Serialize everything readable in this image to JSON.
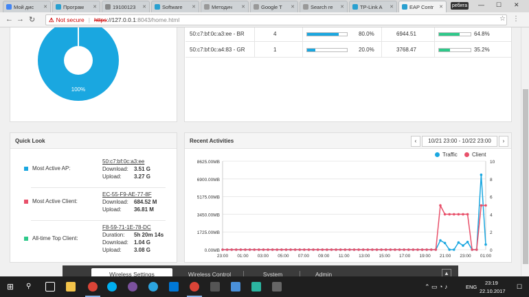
{
  "browser": {
    "tabs": [
      {
        "label": "Мой дис",
        "color": "#4285f4"
      },
      {
        "label": "Програм",
        "color": "#29a0d0"
      },
      {
        "label": "19100123",
        "color": "#888888"
      },
      {
        "label": "Software",
        "color": "#29a0d0"
      },
      {
        "label": "Методич",
        "color": "#999999"
      },
      {
        "label": "Google T",
        "color": "#999999"
      },
      {
        "label": "Search re",
        "color": "#999999"
      },
      {
        "label": "TP-Link A",
        "color": "#29a0d0"
      },
      {
        "label": "EAP Contr",
        "color": "#29a0d0"
      }
    ],
    "profile": "ребята",
    "address": {
      "security": "Not secure",
      "scheme": "https",
      "host": "://127.0.0.1",
      "path": ":8043/home.html"
    }
  },
  "clients_table": {
    "rows": [
      {
        "mac": "50:c7:bf:0c:a3:ee - BR",
        "count": "4",
        "percent1": "80.0%",
        "fill1": 0.8,
        "traffic": "6944.51",
        "percent2": "64.8%",
        "fill2": 0.648
      },
      {
        "mac": "50:c7:bf:0c:a4:83 - GR",
        "count": "1",
        "percent1": "20.0%",
        "fill1": 0.2,
        "traffic": "3768.47",
        "percent2": "35.2%",
        "fill2": 0.352
      }
    ]
  },
  "donut": {
    "label": "100%",
    "color": "#1aa7e0"
  },
  "quick_look": {
    "title": "Quick Look",
    "items": [
      {
        "title": "Most Active AP:",
        "name": "50:c7:bf:0c:a3:ee",
        "color": "#1aa7e0",
        "rows": [
          {
            "k": "Download:",
            "v": "3.51 G"
          },
          {
            "k": "Upload:",
            "v": "3.27 G"
          }
        ]
      },
      {
        "title": "Most Active Client:",
        "name": "EC-55-F9-AE-77-8F",
        "color": "#e8506a",
        "rows": [
          {
            "k": "Download:",
            "v": "684.52 M"
          },
          {
            "k": "Upload:",
            "v": "36.81 M"
          }
        ]
      },
      {
        "title": "All-time Top Client:",
        "name": "F8-59-71-1E-78-DC",
        "color": "#2ec98a",
        "rows": [
          {
            "k": "Duration:",
            "v": "5h 20m 14s"
          },
          {
            "k": "Download:",
            "v": "1.04 G"
          },
          {
            "k": "Upload:",
            "v": "3.08 G"
          }
        ]
      }
    ]
  },
  "recent": {
    "title": "Recent Activities",
    "date_range": "10/21 23:00 - 10/22 23:00",
    "prev": "‹",
    "next": "›"
  },
  "chart_data": {
    "type": "line",
    "title": "",
    "x": [
      "23:00",
      "01:00",
      "03:00",
      "05:00",
      "07:00",
      "09:00",
      "11:00",
      "13:00",
      "15:00",
      "17:00",
      "19:00",
      "21:00",
      "23:00",
      "01:00"
    ],
    "xlabel": "",
    "ylabel": "",
    "yleft_ticks": [
      "0.00MB",
      "1725.00MB",
      "3450.00MB",
      "5175.00MB",
      "6900.00MB",
      "8625.00MB"
    ],
    "yright_ticks": [
      "0",
      "2",
      "4",
      "6",
      "8",
      "10"
    ],
    "ylim_left": [
      0,
      8625
    ],
    "ylim_right": [
      0,
      10
    ],
    "legend_position": "top-right",
    "series": [
      {
        "name": "Traffic",
        "color": "#1aa7e0",
        "axis": "left",
        "values": [
          0,
          0,
          0,
          0,
          0,
          0,
          0,
          0,
          0,
          0,
          0,
          0,
          0,
          0,
          0,
          0,
          0,
          0,
          0,
          0,
          0,
          0,
          0,
          0,
          0,
          0,
          0,
          0,
          0,
          0,
          0,
          0,
          0,
          0,
          0,
          0,
          0,
          0,
          0,
          0,
          0,
          0,
          0,
          0,
          0,
          0,
          0,
          0,
          0,
          0,
          0,
          0,
          0,
          0,
          0,
          0,
          0,
          0,
          0,
          0,
          0,
          0,
          0,
          0,
          0,
          0,
          0,
          0,
          0,
          0,
          0,
          0,
          0,
          0,
          0,
          0,
          0,
          0,
          0,
          0,
          0,
          0,
          0,
          0,
          0,
          0,
          0,
          0,
          0,
          0,
          0,
          0,
          0,
          0,
          0,
          0,
          0,
          0,
          0,
          0,
          0,
          0,
          0,
          0,
          0,
          0,
          0,
          0
        ],
        "points": [
          [
            0,
            0
          ],
          [
            1,
            0
          ],
          [
            2,
            0
          ],
          [
            3,
            0
          ],
          [
            4,
            0
          ],
          [
            5,
            0
          ],
          [
            6,
            0
          ],
          [
            7,
            0
          ],
          [
            8,
            0
          ],
          [
            9,
            0
          ],
          [
            10,
            0
          ],
          [
            11,
            0
          ],
          [
            12,
            0
          ],
          [
            13,
            0
          ],
          [
            14,
            0
          ],
          [
            15,
            0
          ],
          [
            16,
            0
          ],
          [
            17,
            0
          ],
          [
            18,
            0
          ],
          [
            19,
            0
          ],
          [
            20,
            0
          ],
          [
            21,
            0
          ],
          [
            22,
            0
          ],
          [
            23,
            0
          ],
          [
            24,
            0
          ],
          [
            25,
            0
          ],
          [
            26,
            0
          ],
          [
            27,
            0
          ],
          [
            28,
            0
          ],
          [
            29,
            0
          ],
          [
            30,
            0
          ],
          [
            31,
            0
          ],
          [
            32,
            0
          ],
          [
            33,
            0
          ],
          [
            34,
            0
          ],
          [
            35,
            0
          ],
          [
            36,
            0
          ],
          [
            37,
            0
          ],
          [
            38,
            0
          ],
          [
            39,
            0
          ],
          [
            40,
            0
          ],
          [
            41,
            0
          ],
          [
            42,
            0
          ],
          [
            43,
            0
          ],
          [
            44,
            0
          ],
          [
            45,
            0
          ],
          [
            46,
            0
          ],
          [
            47,
            0
          ],
          [
            48,
            900
          ],
          [
            49,
            650
          ],
          [
            50,
            0
          ],
          [
            51,
            0
          ],
          [
            52,
            700
          ],
          [
            53,
            400
          ],
          [
            54,
            750
          ],
          [
            55,
            0
          ],
          [
            56,
            0
          ],
          [
            57,
            7300
          ],
          [
            58,
            500
          ]
        ]
      },
      {
        "name": "Client",
        "color": "#e8506a",
        "axis": "right",
        "points": [
          [
            0,
            0
          ],
          [
            1,
            0
          ],
          [
            2,
            0
          ],
          [
            3,
            0
          ],
          [
            4,
            0
          ],
          [
            5,
            0
          ],
          [
            6,
            0
          ],
          [
            7,
            0
          ],
          [
            8,
            0
          ],
          [
            9,
            0
          ],
          [
            10,
            0
          ],
          [
            11,
            0
          ],
          [
            12,
            0
          ],
          [
            13,
            0
          ],
          [
            14,
            0
          ],
          [
            15,
            0
          ],
          [
            16,
            0
          ],
          [
            17,
            0
          ],
          [
            18,
            0
          ],
          [
            19,
            0
          ],
          [
            20,
            0
          ],
          [
            21,
            0
          ],
          [
            22,
            0
          ],
          [
            23,
            0
          ],
          [
            24,
            0
          ],
          [
            25,
            0
          ],
          [
            26,
            0
          ],
          [
            27,
            0
          ],
          [
            28,
            0
          ],
          [
            29,
            0
          ],
          [
            30,
            0
          ],
          [
            31,
            0
          ],
          [
            32,
            0
          ],
          [
            33,
            0
          ],
          [
            34,
            0
          ],
          [
            35,
            0
          ],
          [
            36,
            0
          ],
          [
            37,
            0
          ],
          [
            38,
            0
          ],
          [
            39,
            0
          ],
          [
            40,
            0
          ],
          [
            41,
            0
          ],
          [
            42,
            0
          ],
          [
            43,
            0
          ],
          [
            44,
            0
          ],
          [
            45,
            0
          ],
          [
            46,
            0
          ],
          [
            47,
            0
          ],
          [
            48,
            5
          ],
          [
            49,
            4
          ],
          [
            50,
            4
          ],
          [
            51,
            4
          ],
          [
            52,
            4
          ],
          [
            53,
            4
          ],
          [
            54,
            4
          ],
          [
            55,
            0
          ],
          [
            56,
            0
          ],
          [
            57,
            5
          ],
          [
            58,
            5
          ]
        ]
      }
    ]
  },
  "bottom_nav": {
    "tabs": [
      "Wireless Settings",
      "Wireless Control",
      "System",
      "Admin"
    ],
    "up": "▲"
  },
  "taskbar": {
    "lang": "ENG",
    "time": "23:19",
    "date": "22.10.2017"
  }
}
